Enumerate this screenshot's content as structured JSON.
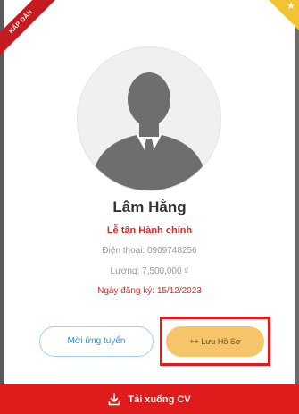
{
  "badge": {
    "label": "HẤP DẪN"
  },
  "candidate": {
    "name": "Lâm Hằng",
    "job_title": "Lễ tân Hành chính",
    "phone": "Điện thoại: 0909748256",
    "salary": "Lương: 7,500,000 ₫",
    "registered": "Ngày đăng ký: 15/12/2023"
  },
  "actions": {
    "view_label": "Mời ứng tuyển",
    "save_label": "++ Lưu Hồ Sơ",
    "download_label": "Tải xuống CV"
  },
  "icons": {
    "corner": "star-icon",
    "download": "download-icon",
    "avatar": "person-silhouette-icon"
  },
  "colors": {
    "accent_red": "#e01b1b",
    "save_button": "#f6c56a",
    "outline_button": "#9fd0ef",
    "corner": "#f2c434"
  }
}
